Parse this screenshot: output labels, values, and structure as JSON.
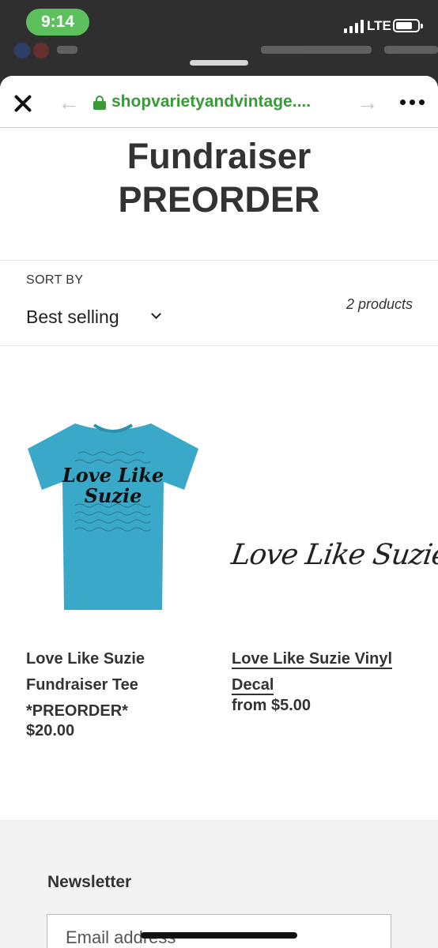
{
  "status_bar": {
    "time": "9:14",
    "network": "LTE"
  },
  "browser": {
    "url": "shopvarietyandvintage....",
    "close_icon": "close-icon",
    "back_icon": "back-arrow-icon",
    "forward_icon": "forward-arrow-icon",
    "more_icon": "more-options-icon",
    "accent_color": "#3a9a3a"
  },
  "collection": {
    "title_line1": "Fundraiser",
    "title_line2": "PREORDER",
    "sort_label": "SORT BY",
    "sort_value": "Best selling",
    "product_count": "2 products"
  },
  "products": [
    {
      "title_line1": "Love Like Suzie",
      "title_line2": "Fundraiser Tee",
      "title_line3": "*PREORDER*",
      "price": "$20.00",
      "image_text_line1": "Love Like",
      "image_text_line2": "Suzie",
      "shirt_color": "#3aa9c9"
    },
    {
      "title_line1": "Love Like Suzie Vinyl",
      "title_line2": "Decal",
      "price": "from $5.00",
      "image_text": "Love Like Suzie"
    }
  ],
  "footer": {
    "newsletter_heading": "Newsletter",
    "email_placeholder": "Email address"
  }
}
